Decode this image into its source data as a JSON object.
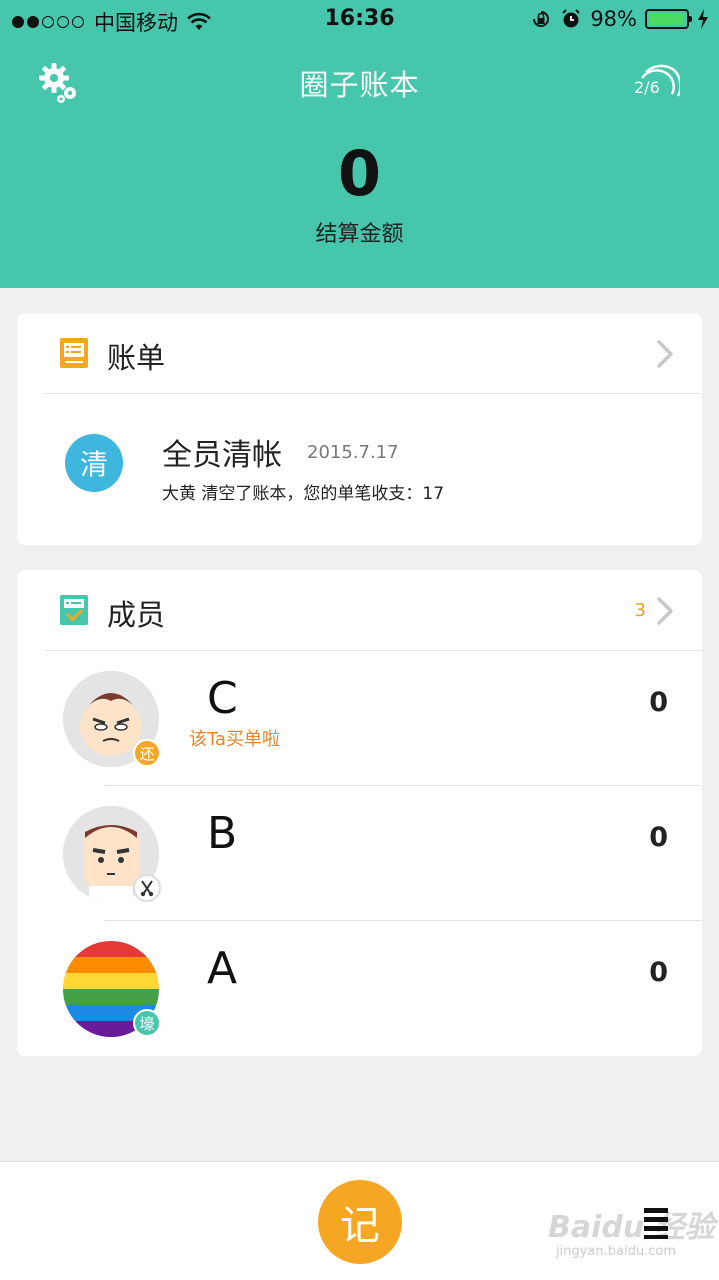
{
  "status_bar": {
    "carrier": "中国移动",
    "time": "16:36",
    "battery": "98%",
    "battery_level": 0.98
  },
  "header": {
    "title": "圈子账本",
    "circle_count": "2/6",
    "settings_icon": "gear-icon",
    "circle_icon": "circles-icon"
  },
  "summary": {
    "amount": "0",
    "label": "结算金额"
  },
  "bills": {
    "title": "账单",
    "entries": [
      {
        "icon_text": "清",
        "title": "全员清帐",
        "date": "2015.7.17",
        "description": "大黄 清空了账本，您的单笔收支：17"
      }
    ]
  },
  "members": {
    "title": "成员",
    "count": "3",
    "list": [
      {
        "name": "C",
        "note": "该Ta买单啦",
        "badge": "还",
        "badge_color": "#f5a623",
        "amount": "0"
      },
      {
        "name": "B",
        "note": "",
        "badge": "",
        "badge_color": "#444444",
        "amount": "0"
      },
      {
        "name": "A",
        "note": "",
        "badge": "壕",
        "badge_color": "#46c6ab",
        "amount": "0"
      }
    ]
  },
  "bottom_bar": {
    "record_label": "记",
    "watermark": "Baidu 经验",
    "watermark_url": "jingyan.baidu.com"
  },
  "colors": {
    "primary": "#46c6ab",
    "accent": "#f5a623",
    "bill_icon": "#3fb6dd"
  }
}
